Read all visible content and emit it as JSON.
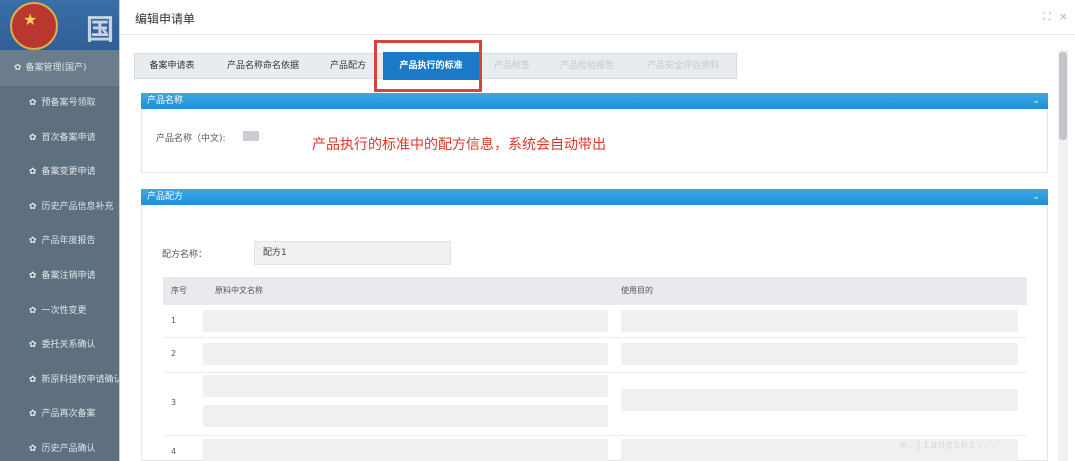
{
  "sidebar": {
    "logo_text": "国",
    "section_header": "备案管理(国产)",
    "items": [
      {
        "label": "预备案号领取"
      },
      {
        "label": "首次备案申请"
      },
      {
        "label": "备案变更申请"
      },
      {
        "label": "历史产品信息补充"
      },
      {
        "label": "产品年度报告"
      },
      {
        "label": "备案注销申请"
      },
      {
        "label": "一次性变更"
      },
      {
        "label": "委托关系确认"
      },
      {
        "label": "新原料授权申请确认"
      },
      {
        "label": "产品再次备案"
      },
      {
        "label": "历史产品确认"
      }
    ]
  },
  "modal": {
    "title": "编辑申请单",
    "controls": {
      "maximize": "⛶",
      "close": "×"
    }
  },
  "tabs": [
    {
      "label": "备案申请表",
      "state": "normal"
    },
    {
      "label": "产品名称命名依据",
      "state": "normal"
    },
    {
      "label": "产品配方",
      "state": "normal"
    },
    {
      "label": "产品执行的标准",
      "state": "active"
    },
    {
      "label": "产品标签",
      "state": "disabled"
    },
    {
      "label": "产品检验报告",
      "state": "disabled"
    },
    {
      "label": "产品安全评估资料",
      "state": "disabled"
    }
  ],
  "name_panel": {
    "title": "产品名称",
    "chevron": "⌄",
    "field_label": "产品名称（中文):"
  },
  "annotation": "产品执行的标准中的配方信息，系统会自动带出",
  "formula_panel": {
    "title": "产品配方",
    "chevron": "⌄",
    "formula_label": "配方名称：",
    "formula_value": "配方1",
    "table": {
      "headers": [
        "序号",
        "原料中文名称",
        "使用目的"
      ],
      "rows": [
        {
          "index": "1"
        },
        {
          "index": "2"
        },
        {
          "index": "3"
        },
        {
          "index": "4"
        }
      ]
    }
  },
  "watermark": "m.jiangshi...",
  "colors": {
    "accent": "#1b79c8",
    "panel_header": "#2b9be0",
    "annotation": "#e0362c",
    "highlight_box": "#d8443c"
  }
}
